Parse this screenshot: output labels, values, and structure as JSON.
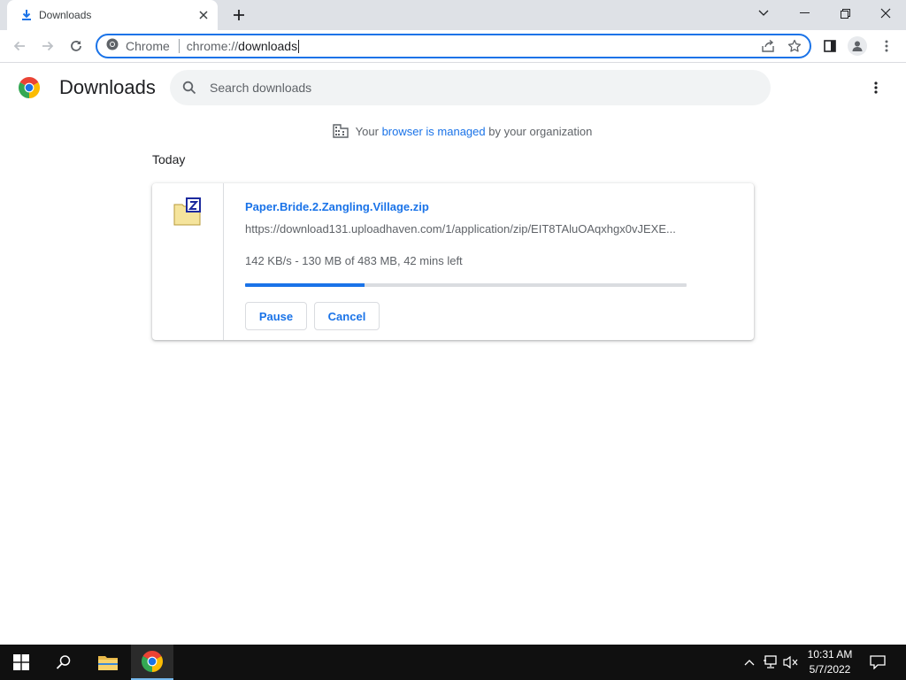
{
  "window": {
    "tab_title": "Downloads",
    "controls": {
      "minimize": "minimize",
      "restore": "restore",
      "close": "close"
    }
  },
  "toolbar": {
    "omnibox_chip": "Chrome",
    "url_scheme": "chrome://",
    "url_path": "downloads"
  },
  "page": {
    "title": "Downloads",
    "search_placeholder": "Search downloads",
    "managed_prefix": "Your",
    "managed_link": "browser is managed",
    "managed_suffix": "by your organization",
    "day_label": "Today"
  },
  "download": {
    "file_name": "Paper.Bride.2.Zangling.Village.zip",
    "url": "https://download131.uploadhaven.com/1/application/zip/EIT8TAluOAqxhgx0vJEXE...",
    "status": "142 KB/s - 130 MB of 483 MB, 42 mins left",
    "progress_fraction": 0.27,
    "pause_label": "Pause",
    "cancel_label": "Cancel"
  },
  "taskbar": {
    "time": "10:31 AM",
    "date": "5/7/2022"
  },
  "colors": {
    "accent": "#1a73e8",
    "tabstrip": "#dee1e6",
    "taskbar": "#101010"
  }
}
